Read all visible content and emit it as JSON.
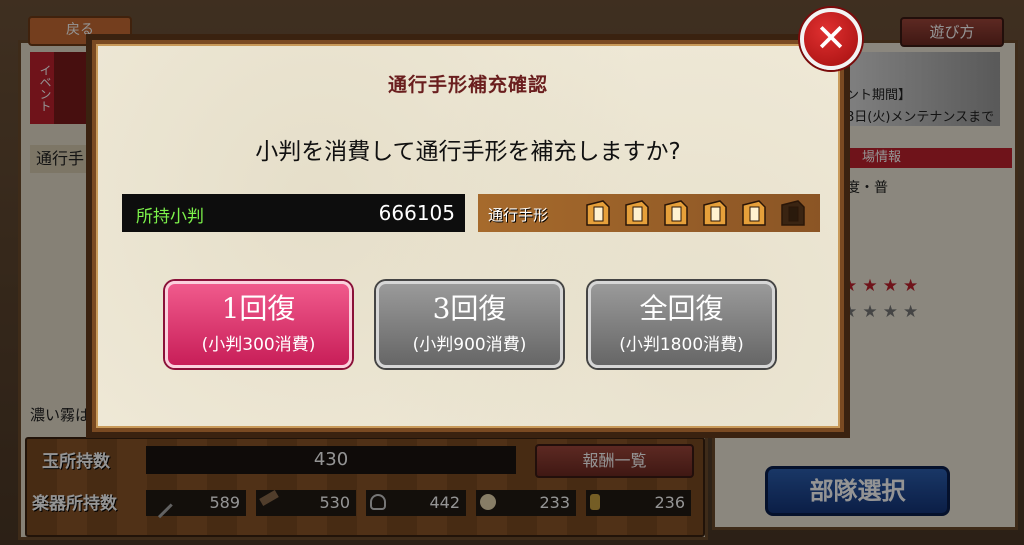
{
  "background": {
    "back_button": "戻る",
    "howto_button": "遊び方",
    "event_tab": "イベント",
    "left_section_label": "通行手",
    "notice_period": "ント期間】",
    "notice_maintenance": "8日(火)メンテナンスまで",
    "stage_info_header": "場情報",
    "difficulty_text": "度・普",
    "fog_text": "濃い霧は",
    "bottom": {
      "tama_label": "玉所持数",
      "tama_value": "430",
      "reward_button": "報酬一覧",
      "instrument_label": "楽器所持数",
      "instruments": [
        {
          "icon": "flute-icon",
          "value": "589"
        },
        {
          "icon": "drum-stick-icon",
          "value": "530"
        },
        {
          "icon": "shamisen-icon",
          "value": "442"
        },
        {
          "icon": "taiko-icon",
          "value": "233"
        },
        {
          "icon": "bell-icon",
          "value": "236"
        }
      ]
    },
    "deploy_button": "部隊選択"
  },
  "modal": {
    "title": "通行手形補充確認",
    "question": "小判を消費して通行手形を補充しますか?",
    "koban_label": "所持小判",
    "koban_value": "666105",
    "pass_label": "通行手形",
    "passes_filled": 5,
    "passes_total": 6,
    "buttons": [
      {
        "main": "1回復",
        "sub": "(小判300消費)",
        "style": "pink"
      },
      {
        "main": "3回復",
        "sub": "(小判900消費)",
        "style": "grey"
      },
      {
        "main": "全回復",
        "sub": "(小判1800消費)",
        "style": "grey"
      }
    ],
    "close_icon": "close-icon"
  },
  "colors": {
    "pink_button": "#e0356f",
    "grey_button": "#7d7d7d",
    "koban_label": "#7cf24a",
    "title": "#6a1e1e"
  }
}
